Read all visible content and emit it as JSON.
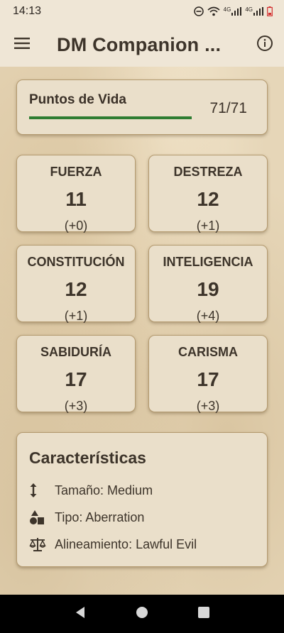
{
  "status": {
    "time": "14:13",
    "net1": "4G",
    "net2": "4G"
  },
  "app": {
    "title": "DM Companion ..."
  },
  "hp": {
    "label": "Puntos de Vida",
    "value": "71/71",
    "fraction": 1.0,
    "bar_color": "#2e7d32"
  },
  "stats": [
    {
      "name": "FUERZA",
      "score": "11",
      "mod": "(+0)"
    },
    {
      "name": "DESTREZA",
      "score": "12",
      "mod": "(+1)"
    },
    {
      "name": "CONSTITUCIÓN",
      "score": "12",
      "mod": "(+1)"
    },
    {
      "name": "INTELIGENCIA",
      "score": "19",
      "mod": "(+4)"
    },
    {
      "name": "SABIDURÍA",
      "score": "17",
      "mod": "(+3)"
    },
    {
      "name": "CARISMA",
      "score": "17",
      "mod": "(+3)"
    }
  ],
  "characteristics": {
    "title": "Características",
    "rows": [
      {
        "icon": "height-arrows-icon",
        "text": "Tamaño: Medium"
      },
      {
        "icon": "shapes-icon",
        "text": "Tipo: Aberration"
      },
      {
        "icon": "scales-icon",
        "text": "Alineamiento: Lawful Evil"
      }
    ]
  },
  "icons": {
    "menu": "menu-icon",
    "info": "info-icon",
    "back": "back-icon",
    "home": "home-icon",
    "recents": "recents-icon"
  }
}
